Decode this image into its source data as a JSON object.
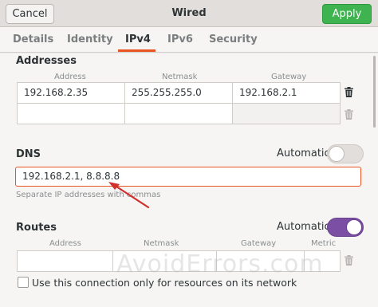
{
  "header": {
    "cancel_label": "Cancel",
    "title": "Wired",
    "apply_label": "Apply",
    "apply_color": "#3eb34f"
  },
  "tabs": [
    {
      "label": "Details"
    },
    {
      "label": "Identity"
    },
    {
      "label": "IPv4",
      "active": true
    },
    {
      "label": "IPv6"
    },
    {
      "label": "Security"
    }
  ],
  "addresses": {
    "title": "Addresses",
    "columns": [
      "Address",
      "Netmask",
      "Gateway"
    ],
    "rows": [
      {
        "address": "192.168.2.35",
        "netmask": "255.255.255.0",
        "gateway": "192.168.2.1"
      },
      {
        "address": "",
        "netmask": "",
        "gateway": ""
      }
    ],
    "delete_icon": "trash-icon"
  },
  "dns": {
    "title": "DNS",
    "automatic_label": "Automatic",
    "automatic_on": false,
    "value": "192.168.2.1, 8.8.8.8",
    "hint": "Separate IP addresses with commas",
    "focus_color": "#e95420"
  },
  "routes": {
    "title": "Routes",
    "automatic_label": "Automatic",
    "automatic_on": true,
    "toggle_color": "#7b4fa3",
    "columns": [
      "Address",
      "Netmask",
      "Gateway",
      "Metric"
    ],
    "rows": [
      {
        "address": "",
        "netmask": "",
        "gateway": "",
        "metric": ""
      }
    ]
  },
  "only_local": {
    "label": "Use this connection only for resources on its network",
    "checked": false
  },
  "watermark": "AvoidErrors.com",
  "annotation": {
    "type": "arrow",
    "color": "#d0312d"
  }
}
